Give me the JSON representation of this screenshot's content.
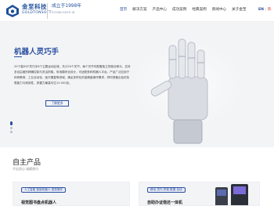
{
  "header": {
    "logo_cn": "金至科技",
    "logo_en": "GOLDTONSOFT",
    "slogan": "成立于1998年",
    "slogan_en": "ESTABLISHED IN",
    "nav": [
      "首页",
      "解决方案",
      "产品中心",
      "成功案例",
      "经典案例",
      "新闻中心",
      "关于金至"
    ],
    "active_nav": "首页",
    "lang_en": "EN",
    "lang_sep": "|",
    "lang_cn": "简"
  },
  "hero": {
    "title": "机器人灵巧手",
    "description": "20个高DOF灵巧手6个主要运动区域，共计20个关节，每个关节均配备独立的驱动单元，支持多自由度的精确控制与灵活抓取，采用模块化设计，可适配多种机器人平台。产品广泛应用于科研教育、工业自动化、医疗康复等领域，满足多样化的高精度操作需求，同时具备出色的负载能力与耐用性，抓握力最高可达15.000克。",
    "button": "了解更多",
    "colors": {
      "accent": "#2a4fa0"
    }
  },
  "products": {
    "title": "自主产品",
    "subtitle": "不忘初心 砥砺前行",
    "cards": [
      {
        "tag": "人工智能 智能机器人 视觉操作",
        "name": "视觉图书盘点机器人"
      },
      {
        "tag": "移动 灵巧 终端 数据 自动",
        "name": "自助办证借还一体机"
      }
    ]
  }
}
